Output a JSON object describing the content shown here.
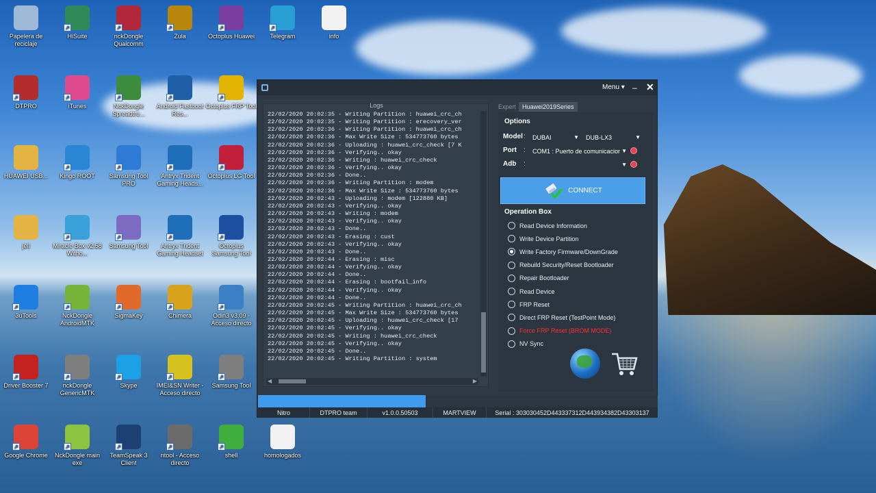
{
  "desktop": {
    "icons": [
      {
        "label": "Papelera de reciclaje",
        "icon": "recycle-bin-icon",
        "color": "#9fb8d6"
      },
      {
        "label": "HiSuite",
        "icon": "hisuite-icon",
        "color": "#2e8b57"
      },
      {
        "label": "nckDongle Qualcomm",
        "icon": "nck-qualcomm-icon",
        "color": "#b2283a"
      },
      {
        "label": "Zula",
        "icon": "zula-icon",
        "color": "#b8860b"
      },
      {
        "label": "Octoplus Huawei",
        "icon": "octoplus-huawei-icon",
        "color": "#7a3fa0"
      },
      {
        "label": "Telegram",
        "icon": "telegram-icon",
        "color": "#2a9fd6"
      },
      {
        "label": "info",
        "icon": "text-file-icon",
        "color": "#f2f2f2"
      },
      {
        "label": "DTPRO",
        "icon": "winrar-icon",
        "color": "#b32d2d"
      },
      {
        "label": "iTunes",
        "icon": "itunes-icon",
        "color": "#e04b8f"
      },
      {
        "label": "NckDongle Spreadtru...",
        "icon": "android-spreadtrum-icon",
        "color": "#3d8b3d"
      },
      {
        "label": "Android Fastboot Res...",
        "icon": "motorola-icon",
        "color": "#1f5fa8"
      },
      {
        "label": "Octoplus FRP Tool",
        "icon": "octoplus-frp-icon",
        "color": "#e0b400"
      },
      {
        "label": "HUAWEI USB...",
        "icon": "folder-icon",
        "color": "#e3b343"
      },
      {
        "label": "Kingo ROOT",
        "icon": "kingo-root-icon",
        "color": "#2a86d4"
      },
      {
        "label": "Samsung Tool PRO",
        "icon": "gear-icon",
        "color": "#2e7bd6"
      },
      {
        "label": "Antryx Trident Gaming Heads...",
        "icon": "headset-icon",
        "color": "#1f6fb8"
      },
      {
        "label": "Octoplus LG Tool",
        "icon": "octoplus-lg-icon",
        "color": "#c2203a"
      },
      {
        "label": "jell",
        "icon": "folder-icon",
        "color": "#e3b343"
      },
      {
        "label": "Miracle Box v2.58 Witho...",
        "icon": "miracle-box-icon",
        "color": "#3aa0d8"
      },
      {
        "label": "Samsung Tool",
        "icon": "gear-icon",
        "color": "#7d6bc2"
      },
      {
        "label": "Antryx Trident Gaming Headset",
        "icon": "headset-icon",
        "color": "#1f6fb8"
      },
      {
        "label": "Octoplus Samsung Tool",
        "icon": "octoplus-samsung-icon",
        "color": "#1d4fa0"
      },
      {
        "label": "3uTools",
        "icon": "3utools-icon",
        "color": "#1f7fe0"
      },
      {
        "label": "NckDongle AndroidMTK",
        "icon": "android-icon",
        "color": "#78b33a"
      },
      {
        "label": "SigmaKey",
        "icon": "sigmakey-icon",
        "color": "#e06a2a"
      },
      {
        "label": "Chimera",
        "icon": "chimera-icon",
        "color": "#d8a21c"
      },
      {
        "label": "Odin3 v3.09 - Acceso directo",
        "icon": "odin-icon",
        "color": "#3b7fc4"
      },
      {
        "label": "Driver Booster 7",
        "icon": "driver-booster-icon",
        "color": "#c4221e"
      },
      {
        "label": "nckDongle GenericMTK",
        "icon": "phone-icon",
        "color": "#7f7f7f"
      },
      {
        "label": "Skype",
        "icon": "skype-icon",
        "color": "#1da1e6"
      },
      {
        "label": "IMEI&SN Writer - Acceso directo",
        "icon": "imei-writer-icon",
        "color": "#d6c21f"
      },
      {
        "label": "Samsung Tool",
        "icon": "gear-icon",
        "color": "#7f7f7f"
      },
      {
        "label": "Google Chrome",
        "icon": "chrome-icon",
        "color": "#db4437"
      },
      {
        "label": "NckDongle main exe",
        "icon": "android-icon",
        "color": "#8cc43f"
      },
      {
        "label": "TeamSpeak 3 Client",
        "icon": "teamspeak-icon",
        "color": "#1c3f74"
      },
      {
        "label": "ntool - Acceso directo",
        "icon": "nokia-phone-icon",
        "color": "#6b6b6b"
      },
      {
        "label": "shell",
        "icon": "play-icon",
        "color": "#3fae3f"
      },
      {
        "label": "homologados",
        "icon": "text-file-icon",
        "color": "#f2f2f2"
      }
    ]
  },
  "window": {
    "menu_label": "Menu",
    "min_glyph": "–",
    "close_glyph": "✕",
    "logs": {
      "title": "Logs",
      "lines": [
        "22/02/2020 20:02:35 - Writing Partition : huawei_crc_ch",
        "22/02/2020 20:02:35 - Writing Partition : erecovery_ver",
        "22/02/2020 20:02:36 - Writing Partition : huawei_crc_ch",
        "22/02/2020 20:02:36 - Max Write Size : 534773760 bytes",
        "22/02/2020 20:02:36 - Uploading : huawei_crc_check [7 K",
        "22/02/2020 20:02:36 - Verifying.. okay",
        "22/02/2020 20:02:36 - Writing : huawei_crc_check",
        "22/02/2020 20:02:36 - Verifying.. okay",
        "22/02/2020 20:02:36 - Done..",
        "22/02/2020 20:02:36 - Writing Partition : modem",
        "22/02/2020 20:02:36 - Max Write Size : 534773760 bytes",
        "22/02/2020 20:02:43 - Uploading : modem [122880 KB]",
        "22/02/2020 20:02:43 - Verifying.. okay",
        "22/02/2020 20:02:43 - Writing : modem",
        "22/02/2020 20:02:43 - Verifying.. okay",
        "22/02/2020 20:02:43 - Done..",
        "22/02/2020 20:02:43 - Erasing : cust",
        "22/02/2020 20:02:43 - Verifying.. okay",
        "22/02/2020 20:02:43 - Done..",
        "22/02/2020 20:02:44 - Erasing : misc",
        "22/02/2020 20:02:44 - Verifying.. okay",
        "22/02/2020 20:02:44 - Done..",
        "22/02/2020 20:02:44 - Erasing : bootfail_info",
        "22/02/2020 20:02:44 - Verifying.. okay",
        "22/02/2020 20:02:44 - Done..",
        "22/02/2020 20:02:45 - Writing Partition : huawei_crc_ch",
        "22/02/2020 20:02:45 - Max Write Size : 534773760 bytes",
        "22/02/2020 20:02:45 - Uploading : huawei_crc_check [17",
        "22/02/2020 20:02:45 - Verifying.. okay",
        "22/02/2020 20:02:45 - Writing : huawei_crc_check",
        "22/02/2020 20:02:45 - Verifying.. okay",
        "22/02/2020 20:02:45 - Done..",
        "22/02/2020 20:02:45 - Writing Partition : system"
      ]
    },
    "tabs": {
      "expert": "Expert",
      "series": "Huawei2019Series"
    },
    "options": {
      "title": "Options",
      "model_label": "Model",
      "model_value": "DUBAI",
      "variant_value": "DUB-LX3",
      "port_label": "Port",
      "port_value": "COM1 : Puerto de comunicacior",
      "adb_label": "Adb",
      "adb_value": "",
      "colon": ":"
    },
    "connect_label": "CONNECT",
    "operation_box": {
      "title": "Operation Box",
      "items": [
        {
          "label": "Read Device Information",
          "selected": false,
          "red": false
        },
        {
          "label": "Write Device Partition",
          "selected": false,
          "red": false
        },
        {
          "label": "Write Factory Firmware/DownGrade",
          "selected": true,
          "red": false
        },
        {
          "label": "Rebuild Security/Reset Bootloader",
          "selected": false,
          "red": false
        },
        {
          "label": "Repair Bootloader",
          "selected": false,
          "red": false
        },
        {
          "label": "Read Device",
          "selected": false,
          "red": false
        },
        {
          "label": "FRP Reset",
          "selected": false,
          "red": false
        },
        {
          "label": "Direct FRP Reset (TestPoint Mode)",
          "selected": false,
          "red": false
        },
        {
          "label": "Force FRP Reset (BROM MODE)",
          "selected": false,
          "red": true
        },
        {
          "label": "NV Sync",
          "selected": false,
          "red": false
        }
      ]
    },
    "progress": 0.42,
    "status": {
      "nitro": "Nitro",
      "team": "DTPRO team",
      "version": "v1.0.0.50503",
      "author": "MARTVIEW",
      "serial": "Serial : 303030452D443337312D443934382D43303137"
    },
    "colors": {
      "accent": "#4a9fe8",
      "progress": "#3e9bee",
      "window_bg": "#2f3a45",
      "warn": "#ff2f2f"
    }
  }
}
